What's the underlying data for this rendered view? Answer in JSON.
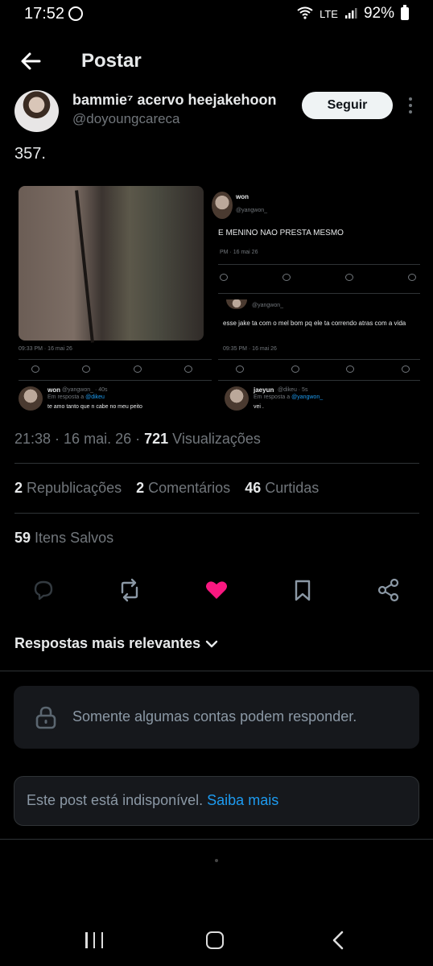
{
  "status": {
    "time": "17:52",
    "battery": "92%",
    "network": "LTE"
  },
  "header": {
    "title": "Postar"
  },
  "author": {
    "name": "bammie⁷ acervo heejakehoon",
    "handle": "@doyoungcareca",
    "follow_label": "Seguir"
  },
  "post": {
    "text": "357."
  },
  "media": {
    "left": {
      "timestamp": "09:33 PM · 16 mai 26",
      "reply_name": "won",
      "reply_meta": "@yangwon_ · 40s",
      "reply_to_prefix": "Em resposta a",
      "reply_to": "@dikeu",
      "reply_text": "te amo tanto que n cabe no meu peito"
    },
    "right": {
      "name": "won",
      "handle": "@yangwon_",
      "tweet_text": "E MENINO NAO PRESTA MESMO",
      "tweet_time": "PM · 16 mai 26",
      "quote_handle": "@yangwon_",
      "quote_text": "esse jake ta com o mel bom pq ele ta correndo atras com a vida",
      "quote_time": "09:35 PM · 16 mai 26",
      "reply_name": "jaeyun",
      "reply_meta": "@dikeu · 5s",
      "reply_to_prefix": "Em resposta a",
      "reply_to": "@yangwon_",
      "reply_text": "vei ."
    }
  },
  "meta": {
    "time": "21:38",
    "date": "16 mai. 26",
    "views_count": "721",
    "views_label": "Visualizações"
  },
  "stats": {
    "reposts_count": "2",
    "reposts_label": "Republicações",
    "comments_count": "2",
    "comments_label": "Comentários",
    "likes_count": "46",
    "likes_label": "Curtidas",
    "saved_count": "59",
    "saved_label": "Itens Salvos"
  },
  "replies": {
    "sort_label": "Respostas mais relevantes"
  },
  "notices": {
    "restricted": "Somente algumas contas podem responder.",
    "unavailable": "Este post está indisponível.",
    "learn_more": "Saiba mais"
  },
  "colors": {
    "accent": "#1d9bf0",
    "like": "#f91880",
    "background": "#000000",
    "muted": "#71767b"
  },
  "icons": [
    "back-arrow-icon",
    "more-vertical-icon",
    "reply-icon",
    "repost-icon",
    "like-icon",
    "bookmark-icon",
    "share-icon",
    "lock-icon",
    "chevron-down-icon"
  ]
}
